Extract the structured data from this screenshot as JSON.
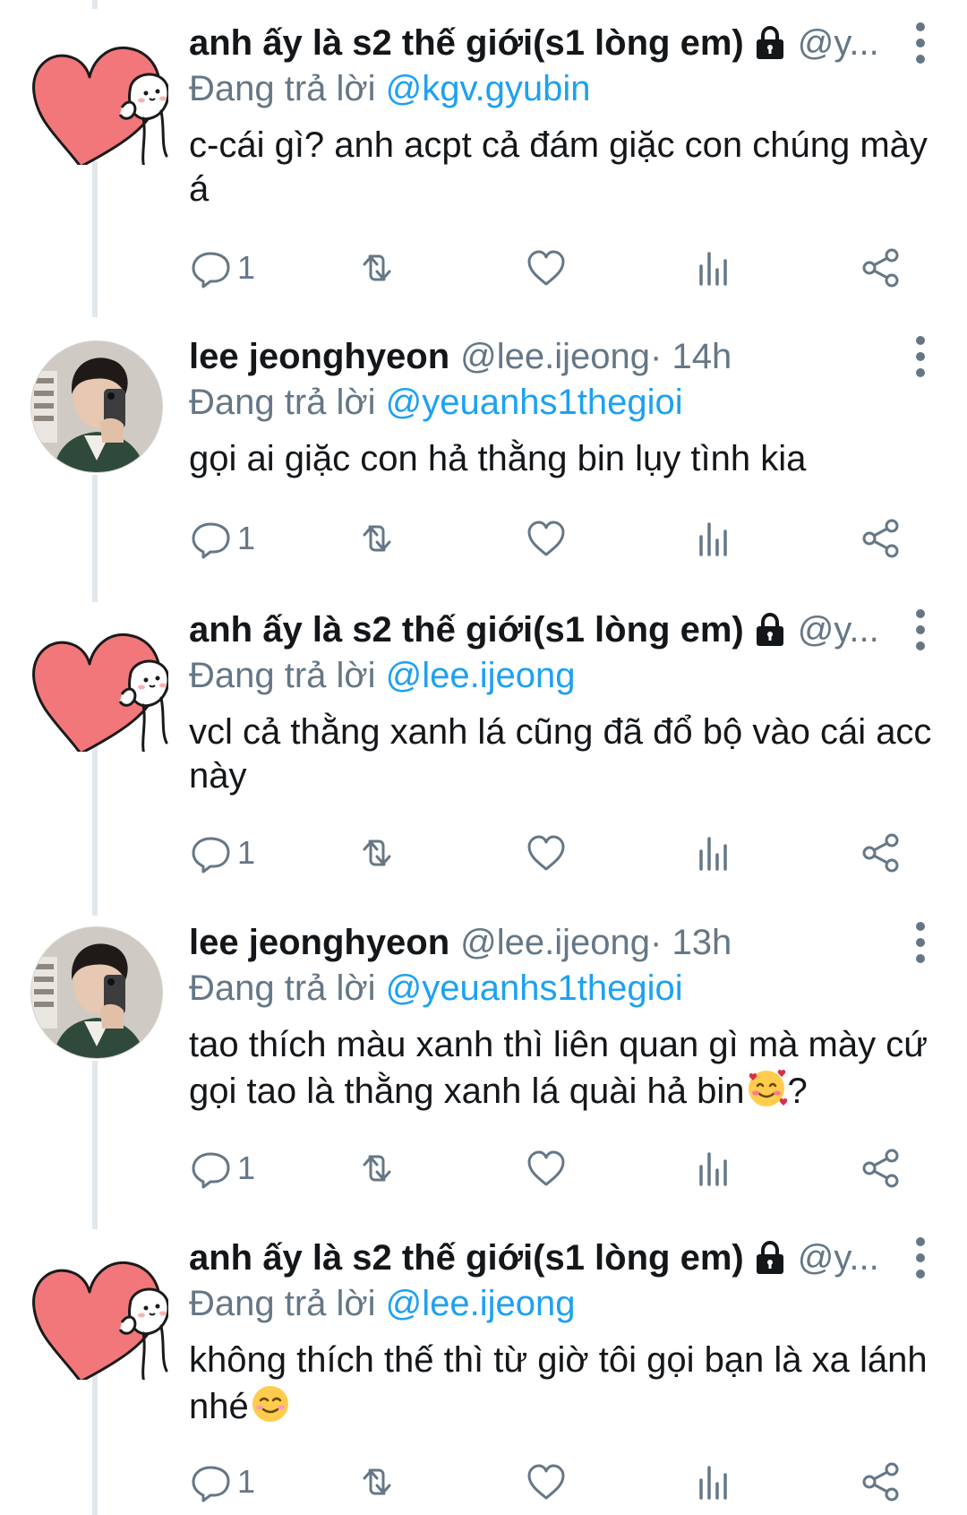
{
  "colors": {
    "text": "#14171a",
    "secondary": "#657786",
    "link": "#1da1f2",
    "thread_line": "#e1e8ed"
  },
  "tweets": [
    {
      "name": "anh ấy là s2 thế giới(s1 lòng em)",
      "protected": true,
      "handle": "@y...",
      "time": "",
      "replying_label": "Đang trả lời",
      "replying_to": "@kgv.gyubin",
      "text": "c-cái gì? anh acpt cả đám giặc con chúng mày á",
      "emoji": "",
      "reply_count": "1",
      "avatar": "heart-avatar"
    },
    {
      "name": "lee jeonghyeon",
      "protected": false,
      "handle": "@lee.ijeong",
      "time": " · 14h",
      "replying_label": "Đang trả lời",
      "replying_to": "@yeuanhs1thegioi",
      "text": "gọi ai giặc con hả thằng bin lụy tình kia",
      "emoji": "",
      "reply_count": "1",
      "avatar": "photo-avatar"
    },
    {
      "name": "anh ấy là s2 thế giới(s1 lòng em)",
      "protected": true,
      "handle": "@y...",
      "time": "",
      "replying_label": "Đang trả lời",
      "replying_to": "@lee.ijeong",
      "text": "vcl cả thằng xanh lá cũng đã đổ bộ vào cái acc này",
      "emoji": "",
      "reply_count": "1",
      "avatar": "heart-avatar"
    },
    {
      "name": "lee jeonghyeon",
      "protected": false,
      "handle": "@lee.ijeong",
      "time": " · 13h",
      "replying_label": "Đang trả lời",
      "replying_to": "@yeuanhs1thegioi",
      "text": "tao thích màu xanh thì liên quan gì mà mày cứ gọi tao là thằng xanh lá quài hả bin",
      "emoji": "smiling-face-with-hearts",
      "text_after_emoji": "?",
      "reply_count": "1",
      "avatar": "photo-avatar"
    },
    {
      "name": "anh ấy là s2 thế giới(s1 lòng em)",
      "protected": true,
      "handle": "@y...",
      "time": "",
      "replying_label": "Đang trả lời",
      "replying_to": "@lee.ijeong",
      "text": "không thích thế thì từ giờ tôi gọi bạn là xa lánh nhé",
      "emoji": "smiling-face",
      "text_after_emoji": "",
      "reply_count": "1",
      "avatar": "heart-avatar"
    }
  ],
  "icons": {
    "reply": "reply-icon",
    "retweet": "retweet-icon",
    "like": "heart-icon",
    "analytics": "analytics-icon",
    "share": "share-icon",
    "more": "more-options-icon",
    "lock": "lock-icon"
  }
}
